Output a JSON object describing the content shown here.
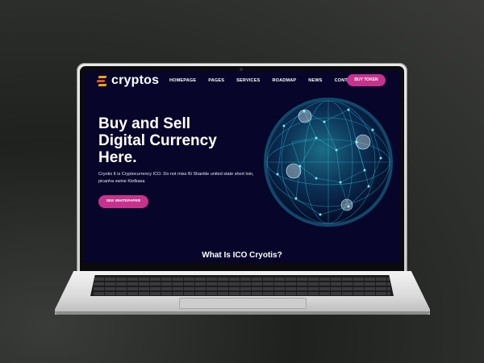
{
  "brand": {
    "name": "cryptos",
    "colors": [
      "#f7a21b",
      "#e8531f",
      "#c6338c"
    ]
  },
  "nav": {
    "items": [
      "HOMEPAGE",
      "PAGES",
      "SERVICES",
      "ROADMAP",
      "NEWS",
      "CONTACTS"
    ],
    "active": "HOMEPAGE",
    "buy_label": "BUY TOKEN"
  },
  "hero": {
    "title_lines": [
      "Buy and Sell",
      "Digital Currency",
      "Here."
    ],
    "description": "Cryotis It is Cryptocurrency ICO. Do not miss Bi Shankle united state short loin, picanha swine Kielbasa",
    "cta_label": "SEE WHITEPAPER",
    "image_icon": "globe-network-icon"
  },
  "section": {
    "title": "What Is ICO Cryotis?"
  },
  "theme": {
    "background": "#07062a",
    "accent": "#c6338c",
    "globe": "#22d3ee"
  }
}
